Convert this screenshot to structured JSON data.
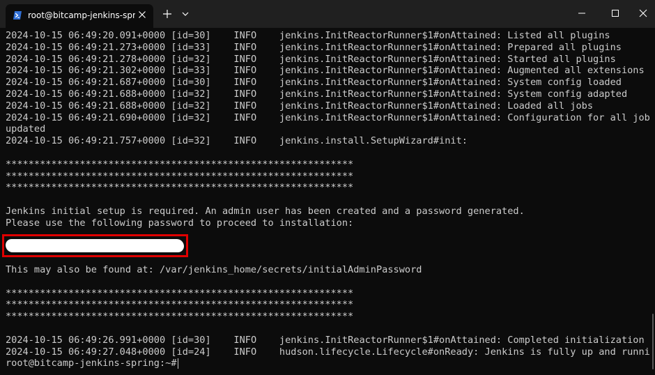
{
  "window": {
    "tab_title": "root@bitcamp-jenkins-spring:",
    "tab_icon": "powershell-icon",
    "new_tab_label": "+",
    "controls": [
      "minimize-icon",
      "maximize-icon",
      "close-icon"
    ]
  },
  "log_lines": [
    {
      "ts": "2024-10-15 06:49:20.091+0000",
      "id": "[id=30]",
      "level": "INFO",
      "msg": "jenkins.InitReactorRunner$1#onAttained: Listed all plugins"
    },
    {
      "ts": "2024-10-15 06:49:21.273+0000",
      "id": "[id=33]",
      "level": "INFO",
      "msg": "jenkins.InitReactorRunner$1#onAttained: Prepared all plugins"
    },
    {
      "ts": "2024-10-15 06:49:21.278+0000",
      "id": "[id=32]",
      "level": "INFO",
      "msg": "jenkins.InitReactorRunner$1#onAttained: Started all plugins"
    },
    {
      "ts": "2024-10-15 06:49:21.302+0000",
      "id": "[id=33]",
      "level": "INFO",
      "msg": "jenkins.InitReactorRunner$1#onAttained: Augmented all extensions"
    },
    {
      "ts": "2024-10-15 06:49:21.687+0000",
      "id": "[id=30]",
      "level": "INFO",
      "msg": "jenkins.InitReactorRunner$1#onAttained: System config loaded"
    },
    {
      "ts": "2024-10-15 06:49:21.688+0000",
      "id": "[id=32]",
      "level": "INFO",
      "msg": "jenkins.InitReactorRunner$1#onAttained: System config adapted"
    },
    {
      "ts": "2024-10-15 06:49:21.688+0000",
      "id": "[id=32]",
      "level": "INFO",
      "msg": "jenkins.InitReactorRunner$1#onAttained: Loaded all jobs"
    },
    {
      "ts": "2024-10-15 06:49:21.690+0000",
      "id": "[id=32]",
      "level": "INFO",
      "msg": "jenkins.InitReactorRunner$1#onAttained: Configuration for all jobs"
    }
  ],
  "wrap_line": "updated",
  "wizard_line": {
    "ts": "2024-10-15 06:49:21.757+0000",
    "id": "[id=32]",
    "level": "INFO",
    "msg": "jenkins.install.SetupWizard#init:"
  },
  "stars": "*************************************************************",
  "setup_message_1": "Jenkins initial setup is required. An admin user has been created and a password generated.",
  "setup_message_2": "Please use the following password to proceed to installation:",
  "found_at": "This may also be found at: /var/jenkins_home/secrets/initialAdminPassword",
  "final_lines": [
    {
      "ts": "2024-10-15 06:49:26.991+0000",
      "id": "[id=30]",
      "level": "INFO",
      "msg": "jenkins.InitReactorRunner$1#onAttained: Completed initialization"
    },
    {
      "ts": "2024-10-15 06:49:27.048+0000",
      "id": "[id=24]",
      "level": "INFO",
      "msg": "hudson.lifecycle.Lifecycle#onReady: Jenkins is fully up and running"
    }
  ],
  "prompt": "root@bitcamp-jenkins-spring:~# "
}
